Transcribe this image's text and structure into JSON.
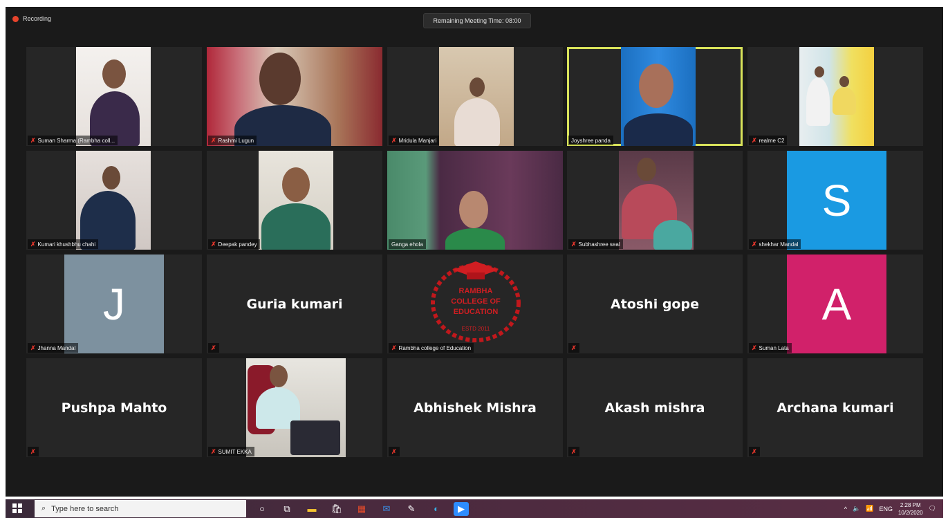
{
  "topbar": {
    "recording_label": "Recording",
    "remaining_time": "Remaining Meeting Time: 08:00"
  },
  "participants": [
    {
      "name": "Suman Sharma (Rambha coll...",
      "type": "video",
      "muted": true
    },
    {
      "name": "Rashmi Lugun",
      "type": "video",
      "muted": true
    },
    {
      "name": "Mridula Manjari",
      "type": "video",
      "muted": true
    },
    {
      "name": "Joyshree panda",
      "type": "video",
      "muted": false,
      "active_speaker": true
    },
    {
      "name": "realme C2",
      "type": "video",
      "muted": true
    },
    {
      "name": "Kumari khushbhu chahi",
      "type": "video",
      "muted": true
    },
    {
      "name": "Deepak pandey",
      "type": "video",
      "muted": true
    },
    {
      "name": "Ganga ehola",
      "type": "video",
      "muted": false
    },
    {
      "name": "Subhashree seal",
      "type": "video",
      "muted": true
    },
    {
      "name": "shekhar Mandal",
      "type": "avatar",
      "initial": "S",
      "color": "#1a9ae2",
      "muted": true
    },
    {
      "name": "Jhanna Mandal",
      "type": "avatar",
      "initial": "J",
      "color": "#7d919f",
      "muted": true
    },
    {
      "name": "Guria kumari",
      "type": "name",
      "muted": true
    },
    {
      "name": "Rambha college of Education",
      "type": "logo",
      "muted": true,
      "logo_text": [
        "RAMBHA",
        "COLLEGE OF",
        "EDUCATION",
        "ESTD 2011"
      ]
    },
    {
      "name": "Atoshi gope",
      "type": "name",
      "muted": true
    },
    {
      "name": "Suman Lata",
      "type": "avatar",
      "initial": "A",
      "color": "#d1216a",
      "muted": true
    },
    {
      "name": "Pushpa Mahto",
      "type": "name",
      "muted": true
    },
    {
      "name": "SUMIT EKKA",
      "type": "video",
      "muted": true
    },
    {
      "name": "Abhishek Mishra",
      "type": "name",
      "muted": true
    },
    {
      "name": "Akash mishra",
      "type": "name",
      "muted": true
    },
    {
      "name": "Archana kumari",
      "type": "name",
      "muted": true
    }
  ],
  "taskbar": {
    "search_placeholder": "Type here to search",
    "language": "ENG",
    "time": "2:28 PM",
    "date": "10/2/2020"
  }
}
